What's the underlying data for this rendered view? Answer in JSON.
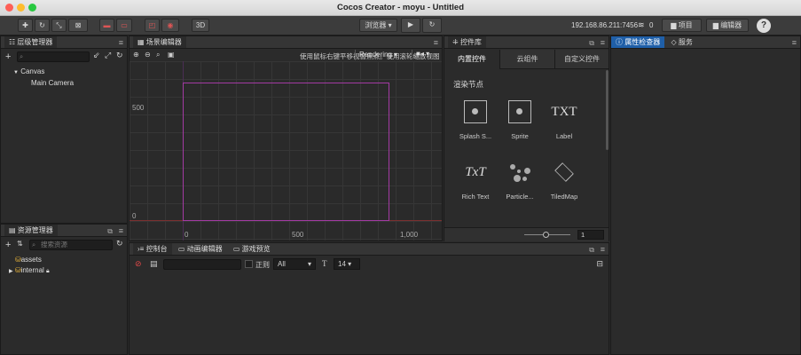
{
  "window": {
    "title": "Cocos Creator - moyu - Untitled"
  },
  "toolbar": {
    "mode_3d": "3D",
    "preview_label": "浏览器 ▾",
    "ip": "192.168.86.211:7456",
    "wifi_count": "0",
    "project_label": "项目",
    "editor_label": "编辑器",
    "help": "?"
  },
  "hierarchy": {
    "title": "层级管理器",
    "search_placeholder": "",
    "items": [
      "Canvas",
      "Main Camera"
    ]
  },
  "scene": {
    "title": "场景编辑器",
    "hint": "使用鼠标右键平移视窗焦点。使用滚轮缩放视图",
    "render_mode": "Rendering",
    "y_labels": [
      "500",
      "0"
    ],
    "x_labels": [
      "0",
      "500",
      "1,000"
    ]
  },
  "library": {
    "title": "控件库",
    "tabs": [
      "内置控件",
      "云组件",
      "自定义控件"
    ],
    "section": "渲染节点",
    "nodes": [
      "Splash S...",
      "Sprite",
      "Label",
      "Rich Text",
      "Particle...",
      "TiledMap"
    ],
    "node_icon_text": {
      "label": "TXT",
      "richtext": "TxT"
    },
    "zoom_value": "1"
  },
  "inspector": {
    "tabs": [
      "属性检查器",
      "服务"
    ]
  },
  "assets": {
    "title": "资源管理器",
    "search_placeholder": "搜索资源",
    "items": [
      "assets",
      "internal"
    ]
  },
  "console": {
    "tabs": [
      "控制台",
      "动画编辑器",
      "游戏预览"
    ],
    "regex_label": "正则",
    "level": "All",
    "font_size": "14"
  },
  "colors": {
    "accent": "#1f5fa8",
    "frame": "#a33aa3",
    "axis": "#7a3030"
  }
}
